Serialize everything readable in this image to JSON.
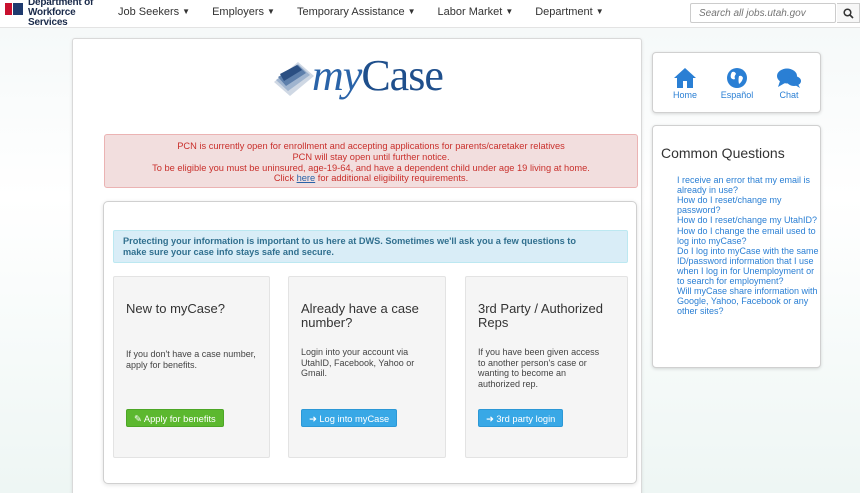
{
  "header": {
    "logo_line1": "Department of",
    "logo_line2": "Workforce Services",
    "nav": [
      {
        "label": "Job Seekers"
      },
      {
        "label": "Employers"
      },
      {
        "label": "Temporary Assistance"
      },
      {
        "label": "Labor Market"
      },
      {
        "label": "Department"
      }
    ],
    "search_placeholder": "Search all jobs.utah.gov"
  },
  "brand": {
    "prefix": "my",
    "suffix": "Case"
  },
  "alert": {
    "line1": "PCN is currently open for enrollment and accepting applications for parents/caretaker relatives",
    "line2": "PCN will stay open until further notice.",
    "line3": "To be eligible you must be uninsured, age-19-64, and have a dependent child under age 19 living at home.",
    "line4_before": "Click",
    "line4_link": "here",
    "line4_after": "for additional eligibility requirements."
  },
  "info": {
    "line1": "Protecting your information is important to us here at DWS. Sometimes we'll ask you a few questions to",
    "line2": "make sure your case info stays safe and secure."
  },
  "panels": [
    {
      "title": "New to myCase?",
      "body": "If you don't have a case number, apply for benefits.",
      "button": "Apply for benefits"
    },
    {
      "title": "Already have a case number?",
      "body": "Login into your account via UtahID, Facebook, Yahoo or Gmail.",
      "button": "Log into myCase"
    },
    {
      "title": "3rd Party / Authorized Reps",
      "body": "If you have been given access to another person's case or wanting to become an authorized rep.",
      "button": "3rd party login"
    }
  ],
  "quicklinks": [
    {
      "label": "Home",
      "icon": "home-icon"
    },
    {
      "label": "Español",
      "icon": "globe-icon"
    },
    {
      "label": "Chat",
      "icon": "chat-icon"
    }
  ],
  "faq": {
    "title": "Common Questions",
    "items": [
      "I receive an error that my email is already in use?",
      "How do I reset/change my password?",
      "How do I reset/change my UtahID?",
      "How do I change the email used to log into myCase?",
      "Do I log into myCase with the same ID/password information that I use when I log in for Unemployment or to search for employment?",
      "Will myCase share information with Google, Yahoo, Facebook or any other sites?"
    ]
  },
  "colors": {
    "brand_blue": "#1f4f8c",
    "link_blue": "#2a7fd4",
    "alert_red": "#c9302c",
    "green_button": "#5cb82f",
    "blue_button": "#38a8e6"
  }
}
